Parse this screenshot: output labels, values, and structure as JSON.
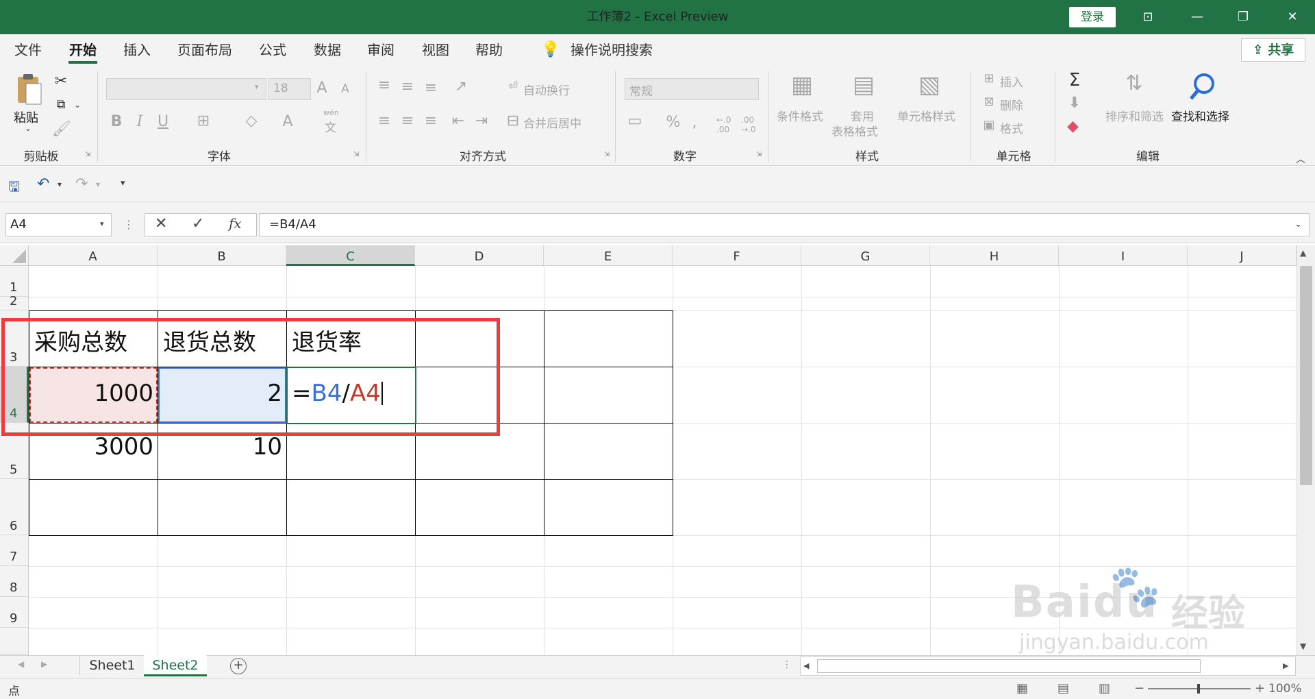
{
  "titlebar": {
    "title": "工作簿2  -  Excel Preview",
    "login": "登录",
    "controls": [
      "⊡",
      "—",
      "❐",
      "✕"
    ]
  },
  "menu": {
    "items": [
      "文件",
      "开始",
      "插入",
      "页面布局",
      "公式",
      "数据",
      "审阅",
      "视图",
      "帮助"
    ],
    "active": "开始",
    "tellme": "操作说明搜索",
    "share": "共享"
  },
  "ribbon": {
    "clipboard": {
      "paste": "粘贴",
      "label": "剪贴板"
    },
    "font": {
      "name": "",
      "size": "18",
      "bold": "B",
      "italic": "I",
      "underline": "U",
      "fontcolor": "A",
      "wen": "wén",
      "wen2": "文",
      "label": "字体",
      "grow": "A",
      "shrink": "A"
    },
    "alignment": {
      "wrap": "自动换行",
      "merge": "合并后居中",
      "label": "对齐方式"
    },
    "number": {
      "format": "常规",
      "percent": "%",
      "comma": ",",
      "inc": "←.0 .00",
      "dec": ".00 →.0",
      "label": "数字"
    },
    "styles": {
      "conditional": "条件格式",
      "table_line1": "套用",
      "table_line2": "表格格式",
      "cell_styles": "单元格样式",
      "label": "样式"
    },
    "cells": {
      "insert": "插入",
      "delete": "删除",
      "format": "格式",
      "label": "单元格"
    },
    "editing": {
      "sum": "Σ",
      "sort": "排序和筛选",
      "find": "查找和选择",
      "label": "编辑"
    }
  },
  "formula_bar": {
    "name_box": "A4",
    "cancel": "✕",
    "enter": "✓",
    "fx": "fx",
    "formula": "=B4/A4"
  },
  "grid": {
    "columns": [
      "A",
      "B",
      "C",
      "D",
      "E",
      "F",
      "G",
      "H",
      "I",
      "J"
    ],
    "rows": [
      "1",
      "2",
      "3",
      "4",
      "5",
      "6",
      "7",
      "8",
      "9"
    ],
    "selected_column": "C",
    "selected_row": "4",
    "cells": {
      "A3": "采购总数",
      "B3": "退货总数",
      "C3": "退货率",
      "A4": "1000",
      "B4": "2",
      "C4_eq": "=",
      "C4_ref1": "B4",
      "C4_slash": "/",
      "C4_ref2": "A4",
      "A5": "3000",
      "B5": "10"
    },
    "ref_colors": {
      "B4": "#3a6fd8",
      "A4": "#c0392b"
    }
  },
  "sheets": {
    "tabs": [
      "Sheet1",
      "Sheet2"
    ],
    "active": "Sheet2"
  },
  "status": {
    "mode": "点",
    "zoom": "100%"
  },
  "watermark": {
    "brand": "Baidu",
    "brand_cn": "经验",
    "url": "jingyan.baidu.com"
  }
}
